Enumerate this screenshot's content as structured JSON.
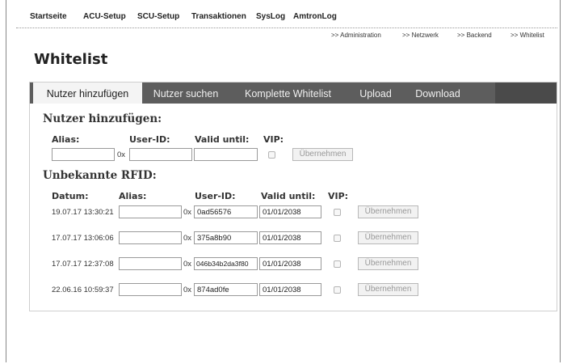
{
  "topnav": [
    "Startseite",
    "ACU-Setup",
    "SCU-Setup",
    "Transaktionen",
    "SysLog",
    "AmtronLog"
  ],
  "subnav": [
    ">> Administration",
    ">> Netzwerk",
    ">> Backend",
    ">> Whitelist"
  ],
  "page_title": "Whitelist",
  "tabs": [
    "Nutzer hinzufügen",
    "Nutzer suchen",
    "Komplette Whitelist",
    "Upload",
    "Download"
  ],
  "add_user": {
    "heading": "Nutzer hinzufügen:",
    "alias_label": "Alias:",
    "userid_label": "User-ID:",
    "valid_label": "Valid until:",
    "vip_label": "VIP:",
    "prefix": "0x",
    "alias_value": "",
    "userid_value": "",
    "valid_value": "",
    "button": "Übernehmen"
  },
  "unknown": {
    "heading": "Unbekannte RFID:",
    "columns": [
      "Datum:",
      "Alias:",
      "User-ID:",
      "Valid until:",
      "VIP:"
    ],
    "prefix": "0x",
    "button": "Übernehmen",
    "rows": [
      {
        "date": "19.07.17 13:30:21",
        "alias": "",
        "userid": "0ad56576",
        "valid": "01/01/2038"
      },
      {
        "date": "17.07.17 13:06:06",
        "alias": "",
        "userid": "375a8b90",
        "valid": "01/01/2038"
      },
      {
        "date": "17.07.17 12:37:08",
        "alias": "",
        "userid": "046b34b2da3f80",
        "valid": "01/01/2038"
      },
      {
        "date": "22.06.16 10:59:37",
        "alias": "",
        "userid": "874ad0fe",
        "valid": "01/01/2038"
      }
    ]
  }
}
